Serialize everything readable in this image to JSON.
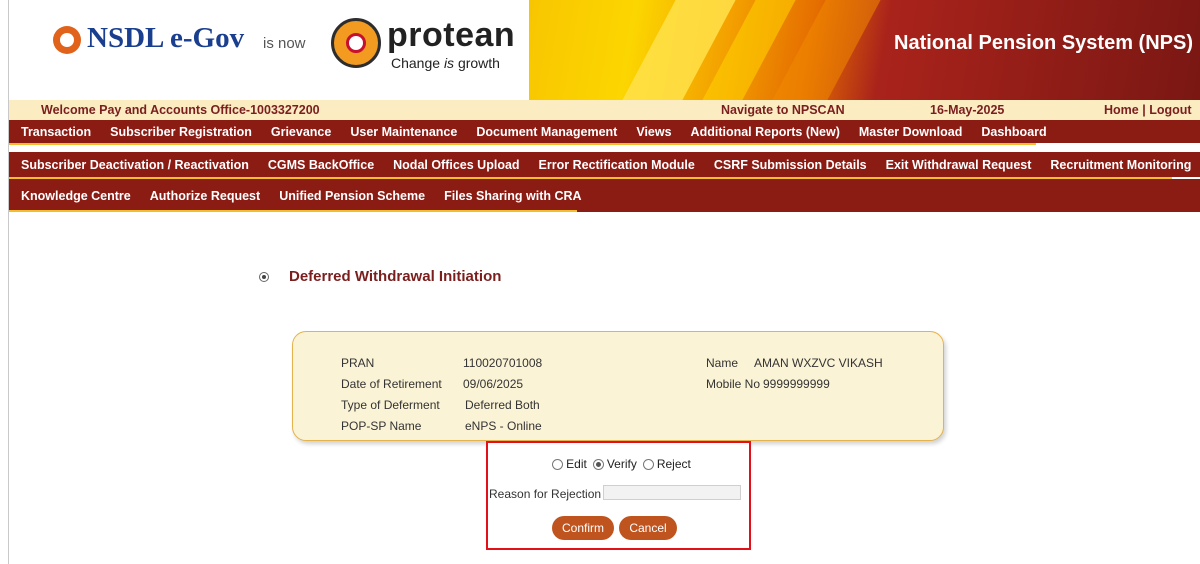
{
  "header": {
    "nsdl_brand": "NSDL e-Gov",
    "is_now": "is now",
    "protean_brand": "protean",
    "protean_tagline_pre": "Change ",
    "protean_tagline_em": "is",
    "protean_tagline_post": " growth",
    "system_title": "National Pension System (NPS)"
  },
  "welcome_bar": {
    "welcome": "Welcome Pay and Accounts Office-1003327200",
    "navigate": "Navigate to NPSCAN",
    "date": "16-May-2025",
    "home": "Home",
    "separator": "|",
    "logout": "Logout"
  },
  "menu_row1": [
    "Transaction",
    "Subscriber Registration",
    "Grievance",
    "User Maintenance",
    "Document Management",
    "Views",
    "Additional Reports (New)",
    "Master Download",
    "Dashboard"
  ],
  "menu_row2": [
    "Subscriber Deactivation / Reactivation",
    "CGMS BackOffice",
    "Nodal Offices Upload",
    "Error Rectification Module",
    "CSRF Submission Details",
    "Exit Withdrawal Request",
    "Recruitment Monitoring"
  ],
  "menu_row3": [
    "Knowledge Centre",
    "Authorize Request",
    "Unified Pension Scheme",
    "Files Sharing with CRA"
  ],
  "page": {
    "title": "Deferred Withdrawal Initiation"
  },
  "details": {
    "pran_label": "PRAN",
    "pran": "110020701008",
    "dor_label": "Date of Retirement",
    "dor": "09/06/2025",
    "deferment_label": "Type of Deferment",
    "deferment": "Deferred Both",
    "popsp_label": "POP-SP Name",
    "popsp": "eNPS - Online",
    "name_label": "Name",
    "name": "AMAN WXZVC VIKASH",
    "mobile_label": "Mobile No",
    "mobile": "9999999999"
  },
  "action": {
    "options": [
      "Edit",
      "Verify",
      "Reject"
    ],
    "selected": "Verify",
    "reason_label": "Reason for Rejection",
    "reason_value": "",
    "confirm": "Confirm",
    "cancel": "Cancel"
  }
}
